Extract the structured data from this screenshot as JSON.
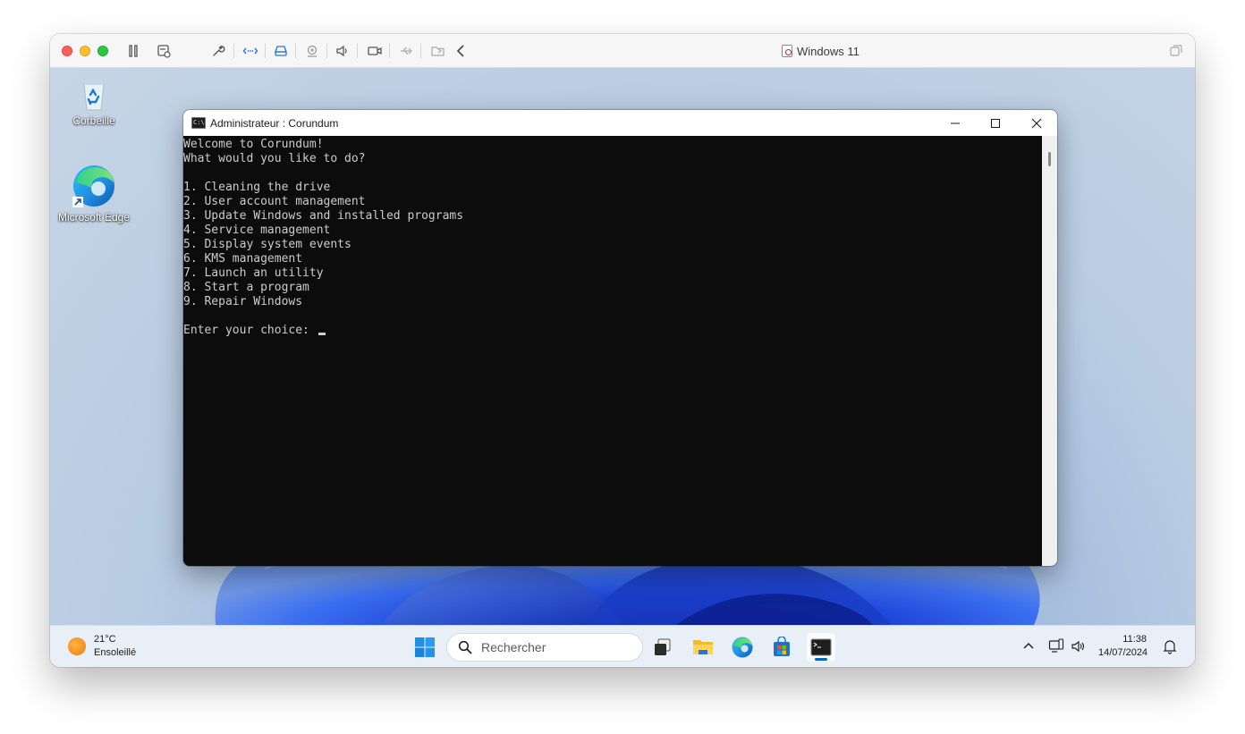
{
  "vm": {
    "title": "Windows 11",
    "toolbar_icons": [
      "pause-icon",
      "snapshot-icon",
      "wrench-icon",
      "network-icon",
      "hard-drive-icon",
      "webcam-icon",
      "audio-icon",
      "camera-icon",
      "usb-icon",
      "shared-folder-icon",
      "chevron-left-icon"
    ]
  },
  "desktop": {
    "icons": [
      {
        "label": "Corbeille",
        "icon": "recycle-bin-icon"
      },
      {
        "label": "Microsoft Edge",
        "icon": "edge-icon"
      }
    ]
  },
  "console": {
    "title": "Administrateur : Corundum",
    "lines": [
      "Welcome to Corundum!",
      "What would you like to do?",
      "",
      "1. Cleaning the drive",
      "2. User account management",
      "3. Update Windows and installed programs",
      "4. Service management",
      "5. Display system events",
      "6. KMS management",
      "7. Launch an utility",
      "8. Start a program",
      "9. Repair Windows",
      "",
      "Enter your choice: "
    ]
  },
  "taskbar": {
    "weather": {
      "temp": "21°C",
      "condition": "Ensoleillé"
    },
    "search_placeholder": "Rechercher",
    "apps": [
      "start-icon",
      "task-view-icon",
      "file-explorer-icon",
      "edge-icon",
      "store-icon",
      "terminal-icon"
    ],
    "clock": {
      "time": "11:38",
      "date": "14/07/2024"
    }
  },
  "colors": {
    "console_bg": "#0c0c0c",
    "console_text": "#cccccc",
    "accent": "#0067c0"
  }
}
